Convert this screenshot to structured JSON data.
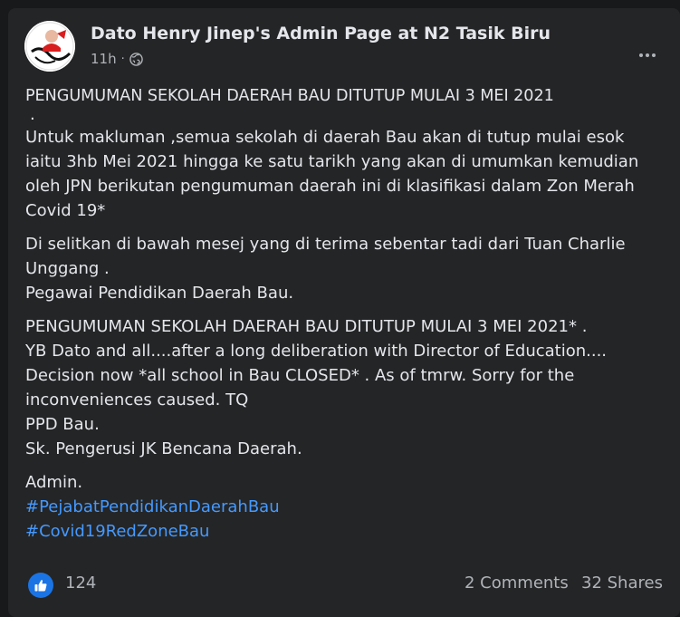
{
  "post": {
    "author": "Dato Henry Jinep's Admin Page at N2 Tasik Biru",
    "time": "11h",
    "separator": "·",
    "privacy_icon": "globe-icon",
    "more_icon": "more-options-icon",
    "body": {
      "title": "PENGUMUMAN SEKOLAH DAERAH BAU DITUTUP MULAI 3 MEI 2021",
      "dot": ".",
      "para1": [
        "Untuk makluman ,semua sekolah di daerah Bau akan di tutup mulai esok",
        "iaitu 3hb Mei 2021 hingga ke satu tarikh yang akan di umumkan kemudian",
        "oleh JPN berikutan pengumuman daerah ini di klasifikasi dalam Zon Merah",
        "Covid 19*"
      ],
      "para2": [
        "Di selitkan di bawah mesej yang di terima sebentar tadi dari Tuan Charlie",
        "Unggang .",
        "Pegawai Pendidikan Daerah Bau."
      ],
      "para3": [
        "PENGUMUMAN SEKOLAH DAERAH BAU DITUTUP MULAI 3 MEI 2021* .",
        "YB Dato and all....after a long deliberation with Director of Education....",
        "Decision now *all school in Bau CLOSED* . As of tmrw. Sorry for the",
        "inconveniences caused. TQ",
        "PPD Bau.",
        "Sk. Pengerusi JK Bencana Daerah."
      ],
      "signoff": "Admin.",
      "hashtags": [
        "#PejabatPendidikanDaerahBau",
        "#Covid19RedZoneBau"
      ]
    },
    "reactions": {
      "like_icon": "thumbs-up-icon",
      "like_color": "#1b74e4",
      "count": "124",
      "comments": "2 Comments",
      "shares": "32 Shares"
    }
  }
}
